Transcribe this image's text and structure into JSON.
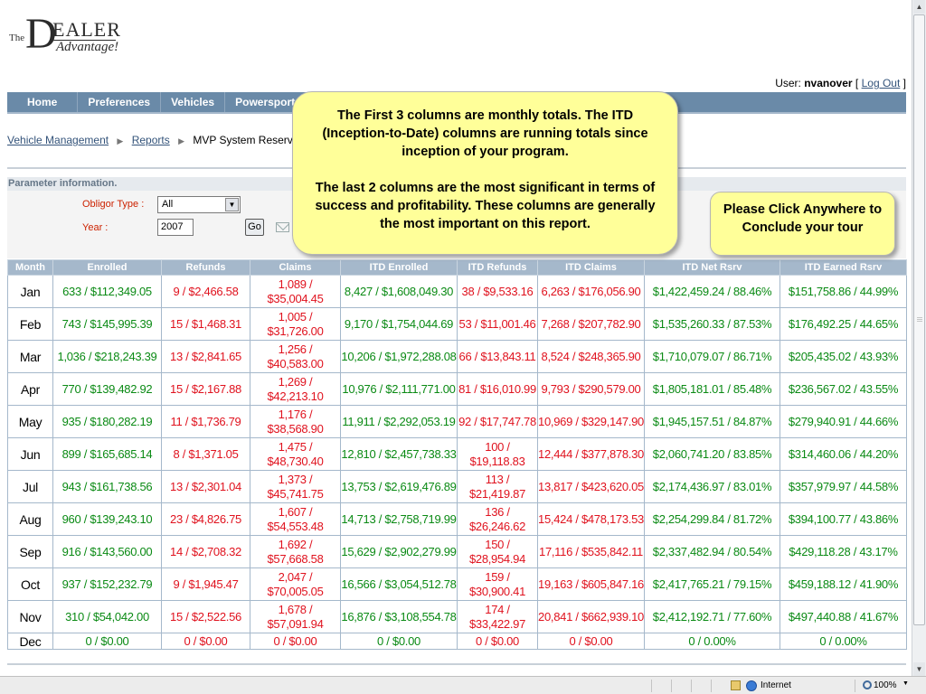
{
  "logo": {
    "the": "The",
    "d": "D",
    "ealer": "EALER",
    "advantage": "Advantage!"
  },
  "user": {
    "label": "User:",
    "name": "nvanover",
    "logout": "Log Out",
    "open_bracket": "[",
    "close_bracket": "]"
  },
  "nav": {
    "items": [
      "Home",
      "Preferences",
      "Vehicles",
      "Powersports"
    ]
  },
  "breadcrumb": {
    "items": [
      "Vehicle Management",
      "Reports"
    ],
    "current": "MVP System Reserve",
    "separator": "▶"
  },
  "params": {
    "header": "Parameter information.",
    "obligor_label": "Obligor Type :",
    "obligor_value": "All",
    "year_label": "Year :",
    "year_value": "2007",
    "go_label": "Go"
  },
  "table": {
    "headers": [
      "Month",
      "Enrolled",
      "Refunds",
      "Claims",
      "ITD Enrolled",
      "ITD Refunds",
      "ITD Claims",
      "ITD Net Rsrv",
      "ITD Earned Rsrv"
    ],
    "rows": [
      [
        "Jan",
        "633 / $112,349.05",
        "9 / $2,466.58",
        "1,089 / $35,004.45",
        "8,427 / $1,608,049.30",
        "38 / $9,533.16",
        "6,263 / $176,056.90",
        "$1,422,459.24 / 88.46%",
        "$151,758.86 / 44.99%"
      ],
      [
        "Feb",
        "743 / $145,995.39",
        "15 / $1,468.31",
        "1,005 / $31,726.00",
        "9,170 / $1,754,044.69",
        "53 / $11,001.46",
        "7,268 / $207,782.90",
        "$1,535,260.33 / 87.53%",
        "$176,492.25 / 44.65%"
      ],
      [
        "Mar",
        "1,036 / $218,243.39",
        "13 / $2,841.65",
        "1,256 / $40,583.00",
        "10,206 / $1,972,288.08",
        "66 / $13,843.11",
        "8,524 / $248,365.90",
        "$1,710,079.07 / 86.71%",
        "$205,435.02 / 43.93%"
      ],
      [
        "Apr",
        "770 / $139,482.92",
        "15 / $2,167.88",
        "1,269 / $42,213.10",
        "10,976 / $2,111,771.00",
        "81 / $16,010.99",
        "9,793 / $290,579.00",
        "$1,805,181.01 / 85.48%",
        "$236,567.02 / 43.55%"
      ],
      [
        "May",
        "935 / $180,282.19",
        "11 / $1,736.79",
        "1,176 / $38,568.90",
        "11,911 / $2,292,053.19",
        "92 / $17,747.78",
        "10,969 / $329,147.90",
        "$1,945,157.51 / 84.87%",
        "$279,940.91 / 44.66%"
      ],
      [
        "Jun",
        "899 / $165,685.14",
        "8 / $1,371.05",
        "1,475 / $48,730.40",
        "12,810 / $2,457,738.33",
        "100 / $19,118.83",
        "12,444 / $377,878.30",
        "$2,060,741.20 / 83.85%",
        "$314,460.06 / 44.20%"
      ],
      [
        "Jul",
        "943 / $161,738.56",
        "13 / $2,301.04",
        "1,373 / $45,741.75",
        "13,753 / $2,619,476.89",
        "113 / $21,419.87",
        "13,817 / $423,620.05",
        "$2,174,436.97 / 83.01%",
        "$357,979.97 / 44.58%"
      ],
      [
        "Aug",
        "960 / $139,243.10",
        "23 / $4,826.75",
        "1,607 / $54,553.48",
        "14,713 / $2,758,719.99",
        "136 / $26,246.62",
        "15,424 / $478,173.53",
        "$2,254,299.84 / 81.72%",
        "$394,100.77 / 43.86%"
      ],
      [
        "Sep",
        "916 / $143,560.00",
        "14 / $2,708.32",
        "1,692 / $57,668.58",
        "15,629 / $2,902,279.99",
        "150 / $28,954.94",
        "17,116 / $535,842.11",
        "$2,337,482.94 / 80.54%",
        "$429,118.28 / 43.17%"
      ],
      [
        "Oct",
        "937 / $152,232.79",
        "9 / $1,945.47",
        "2,047 / $70,005.05",
        "16,566 / $3,054,512.78",
        "159 / $30,900.41",
        "19,163 / $605,847.16",
        "$2,417,765.21 / 79.15%",
        "$459,188.12 / 41.90%"
      ],
      [
        "Nov",
        "310 / $54,042.00",
        "15 / $2,522.56",
        "1,678 / $57,091.94",
        "16,876 / $3,108,554.78",
        "174 / $33,422.97",
        "20,841 / $662,939.10",
        "$2,412,192.71 / 77.60%",
        "$497,440.88 / 41.67%"
      ],
      [
        "Dec",
        "0 / $0.00",
        "0 / $0.00",
        "0 / $0.00",
        "0 / $0.00",
        "0 / $0.00",
        "0 / $0.00",
        "0 / 0.00%",
        "0 / 0.00%"
      ]
    ],
    "column_colors": [
      "#000000",
      "#0a8a14",
      "#e0121e",
      "#e0121e",
      "#0a8a14",
      "#e0121e",
      "#e0121e",
      "#0a8a14",
      "#0a8a14"
    ]
  },
  "callouts": {
    "main_p1": "The First 3 columns are monthly totals. The ITD (Inception-to-Date) columns are running totals since inception of your program.",
    "main_p2": "The last 2 columns are the most significant in terms of success and profitability. These columns are generally the most important on this report.",
    "tour": "Please Click Anywhere to Conclude your tour"
  },
  "status": {
    "zone": "Internet",
    "zoom": "100%"
  },
  "colors": {
    "nav_bg": "#6a8aa8",
    "table_header_bg": "#a5b8cb",
    "callout_bg": "#ffff99",
    "green": "#0a8a14",
    "red": "#e0121e"
  },
  "icons": {
    "mail": "mail-icon",
    "globe": "internet-zone-icon",
    "zoom": "zoom-icon"
  }
}
